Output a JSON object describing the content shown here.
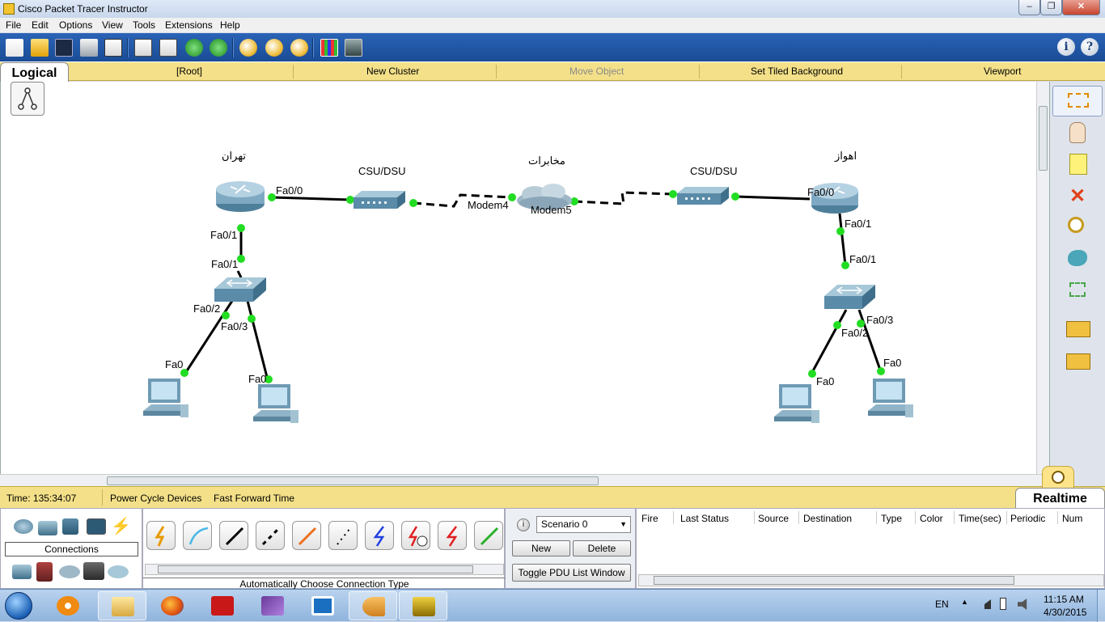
{
  "window": {
    "title": "Cisco Packet Tracer Instructor",
    "minimize": "0",
    "maximize": "1",
    "close": "r"
  },
  "menu": [
    "File",
    "Edit",
    "Options",
    "View",
    "Tools",
    "Extensions",
    "Help"
  ],
  "toolbar_help": "i",
  "toolbar_question": "?",
  "workspace": {
    "tab": "Logical",
    "items": [
      "[Root]",
      "New Cluster",
      "Move Object",
      "Set Tiled Background",
      "Viewport"
    ]
  },
  "network": {
    "devices": [
      {
        "name": "تهران",
        "type": "router"
      },
      {
        "name": "CSU/DSU",
        "type": "csu-dsu"
      },
      {
        "name": "مخابرات",
        "type": "cloud"
      },
      {
        "name": "CSU/DSU",
        "type": "csu-dsu"
      },
      {
        "name": "اهواز",
        "type": "router"
      }
    ],
    "port_labels": {
      "tehran_r_fa00": "Fa0/0",
      "tehran_r_fa01": "Fa0/1",
      "tehran_sw_fa01": "Fa0/1",
      "tehran_sw_fa02": "Fa0/2",
      "tehran_sw_fa03": "Fa0/3",
      "tehran_pc1_fa0": "Fa0",
      "tehran_pc2_fa0": "Fa0",
      "modem4": "Modem4",
      "modem5": "Modem5",
      "ahvaz_r_fa00": "Fa0/0",
      "ahvaz_r_fa01": "Fa0/1",
      "ahvaz_sw_fa01": "Fa0/1",
      "ahvaz_sw_fa02": "Fa0/2",
      "ahvaz_sw_fa03": "Fa0/3",
      "ahvaz_pc1_fa0": "Fa0",
      "ahvaz_pc2_fa0": "Fa0"
    }
  },
  "realtime_bar": {
    "time": "Time: 135:34:07",
    "power_cycle": "Power Cycle Devices",
    "fast_forward": "Fast Forward Time",
    "mode_tab": "Realtime"
  },
  "bottom": {
    "connections_label": "Connections",
    "connection_type": "Automatically Choose Connection Type",
    "scenario": "Scenario 0",
    "new_btn": "New",
    "delete_btn": "Delete",
    "toggle_pdu": "Toggle PDU List Window",
    "event_columns": [
      "Fire",
      "Last Status",
      "Source",
      "Destination",
      "Type",
      "Color",
      "Time(sec)",
      "Periodic",
      "Num"
    ]
  },
  "taskbar": {
    "language": "EN",
    "time": "11:15 AM",
    "date": "4/30/2015"
  },
  "colors": {
    "accent_toolbar": "#1f55a6",
    "workspace_bar": "#f3e088",
    "link_green": "#22dd22"
  }
}
